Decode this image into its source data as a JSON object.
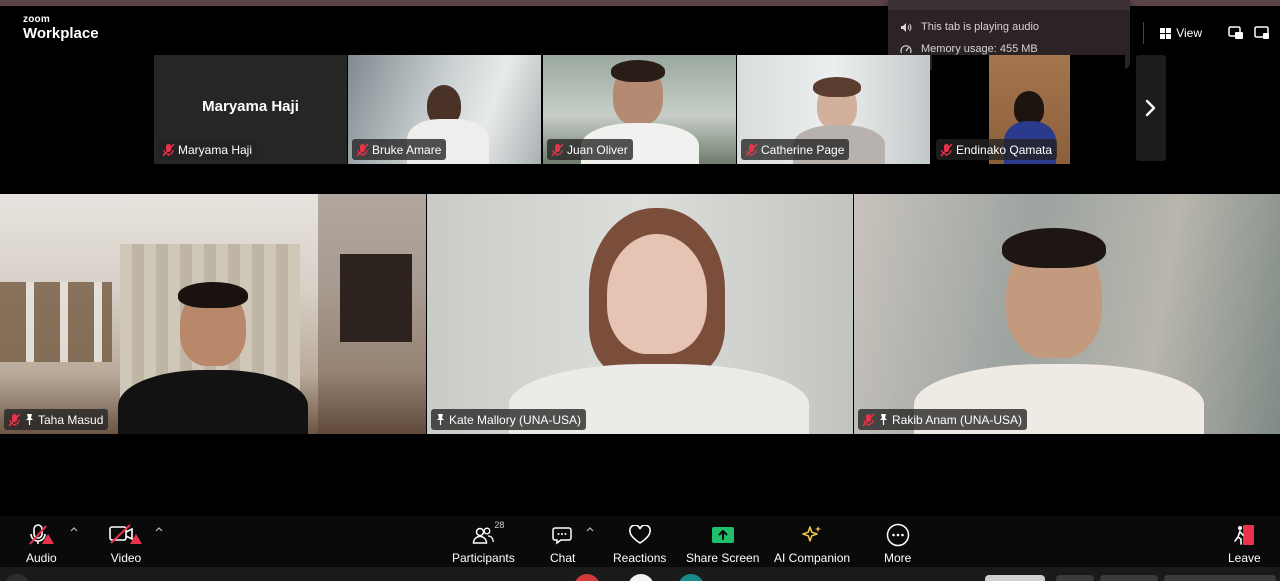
{
  "app": {
    "brand_top": "zoom",
    "brand_name": "Workplace"
  },
  "tooltip": {
    "audio_text": "This tab is playing audio",
    "memory_text": "Memory usage: 455 MB",
    "icons": [
      "speaker-icon",
      "gauge-icon"
    ]
  },
  "top_right": {
    "view_label": "View"
  },
  "strip": {
    "tiles": [
      {
        "name": "Maryama Haji",
        "display_name": "Maryama Haji",
        "video": false,
        "muted": true
      },
      {
        "name": "Bruke Amare",
        "video": true,
        "muted": true
      },
      {
        "name": "Juan Oliver",
        "video": true,
        "muted": true
      },
      {
        "name": "Catherine Page",
        "video": true,
        "muted": true
      },
      {
        "name": "Endinako Qamata",
        "video": true,
        "muted": true
      }
    ]
  },
  "main": {
    "tiles": [
      {
        "name": "Taha Masud",
        "muted": true,
        "pinned": true,
        "active": false
      },
      {
        "name": "Kate Mallory (UNA-USA)",
        "muted": false,
        "pinned": true,
        "active": true
      },
      {
        "name": "Rakib Anam (UNA-USA)",
        "muted": true,
        "pinned": true,
        "active": false
      }
    ]
  },
  "toolbar": {
    "audio_label": "Audio",
    "video_label": "Video",
    "participants_label": "Participants",
    "participants_count": "28",
    "chat_label": "Chat",
    "reactions_label": "Reactions",
    "share_label": "Share Screen",
    "ai_label": "AI Companion",
    "more_label": "More",
    "leave_label": "Leave"
  },
  "colors": {
    "accent_green": "#1fbf6b",
    "warning_red": "#e8344b",
    "active_speaker": "#c9d94b",
    "ai_yellow": "#f2c94c"
  }
}
